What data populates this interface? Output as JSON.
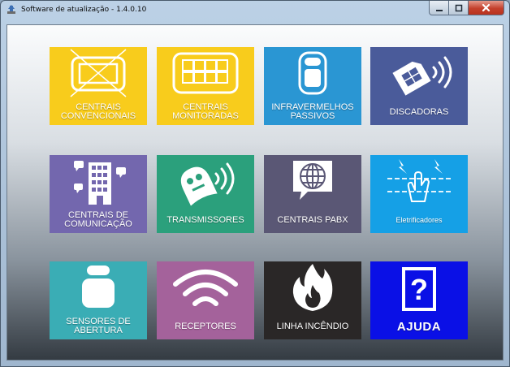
{
  "window": {
    "title": "Software de atualização - 1.4.0.10"
  },
  "tiles": [
    {
      "label": "CENTRAIS CONVENCIONAIS",
      "icon": "crossed-panel-icon",
      "color": "#f8cc1c"
    },
    {
      "label": "CENTRAIS MONITORADAS",
      "icon": "keypad-panel-icon",
      "color": "#f8cc1c"
    },
    {
      "label": "INFRAVERMELHOS PASSIVOS",
      "icon": "motion-sensor-icon",
      "color": "#2a96d3"
    },
    {
      "label": "DISCADORAS",
      "icon": "sim-card-signal-icon",
      "color": "#4a5b9a"
    },
    {
      "label": "CENTRAIS DE COMUNICAÇÃO",
      "icon": "building-icon",
      "color": "#7367ae"
    },
    {
      "label": "TRANSMISSORES",
      "icon": "transmitter-icon",
      "color": "#2ba07c"
    },
    {
      "label": "CENTRAIS PABX",
      "icon": "globe-chat-icon",
      "color": "#5a5775"
    },
    {
      "label": "Eletrificadores",
      "icon": "electric-fence-icon",
      "color": "#15a0e6"
    },
    {
      "label": "SENSORES DE ABERTURA",
      "icon": "door-sensor-icon",
      "color": "#3aadb5"
    },
    {
      "label": "RECEPTORES",
      "icon": "wifi-icon",
      "color": "#a4629b"
    },
    {
      "label": "LINHA INCÊNDIO",
      "icon": "flame-icon",
      "color": "#2a2727"
    },
    {
      "label": "AJUDA",
      "icon": "help-icon",
      "color": "#0a10e6"
    }
  ]
}
